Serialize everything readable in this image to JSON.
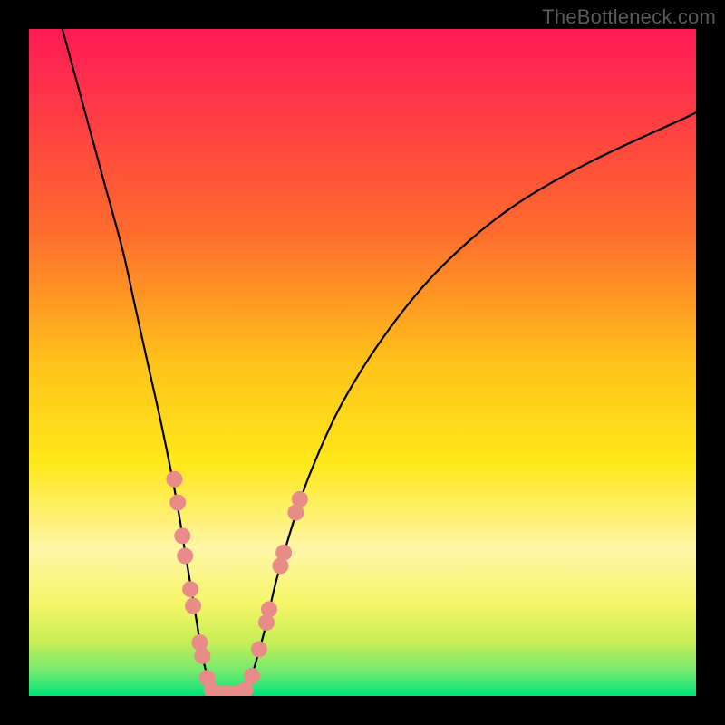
{
  "watermark": "TheBottleneck.com",
  "chart_data": {
    "type": "line",
    "title": "",
    "xlabel": "",
    "ylabel": "",
    "xlim": [
      0,
      100
    ],
    "ylim": [
      0,
      100
    ],
    "background": {
      "type": "vertical-gradient",
      "stops": [
        {
          "offset": 0.0,
          "color": "#ff1a55"
        },
        {
          "offset": 0.12,
          "color": "#ff3a46"
        },
        {
          "offset": 0.3,
          "color": "#ff6a2e"
        },
        {
          "offset": 0.5,
          "color": "#ffc21a"
        },
        {
          "offset": 0.65,
          "color": "#ffe81a"
        },
        {
          "offset": 0.78,
          "color": "#fef6a8"
        },
        {
          "offset": 0.86,
          "color": "#f6f66a"
        },
        {
          "offset": 0.92,
          "color": "#c6ee55"
        },
        {
          "offset": 0.965,
          "color": "#6fe96f"
        },
        {
          "offset": 1.0,
          "color": "#00e47a"
        }
      ]
    },
    "series": [
      {
        "name": "bottleneck-curve",
        "color": "#000000",
        "x": [
          5,
          8,
          11,
          14,
          16,
          18,
          20,
          22,
          23.5,
          25,
          26,
          27,
          27.5,
          28,
          30,
          32,
          33,
          34,
          35.5,
          37,
          39,
          42,
          47,
          54,
          62,
          72,
          84,
          98,
          100
        ],
        "y": [
          100,
          89,
          78,
          67,
          58,
          49,
          40,
          30,
          21,
          12,
          6,
          2,
          0.6,
          0.4,
          0.4,
          0.6,
          2,
          5,
          10.5,
          17,
          24,
          33,
          44,
          55,
          64.5,
          73,
          80,
          86.5,
          87.5
        ]
      }
    ],
    "markers": {
      "name": "data-points",
      "color": "#e98b88",
      "radius_px": 9,
      "points": [
        {
          "x": 21.8,
          "y": 32.5
        },
        {
          "x": 22.3,
          "y": 29.0
        },
        {
          "x": 23.0,
          "y": 24.0
        },
        {
          "x": 23.4,
          "y": 21.0
        },
        {
          "x": 24.2,
          "y": 16.0
        },
        {
          "x": 24.6,
          "y": 13.5
        },
        {
          "x": 25.6,
          "y": 8.0
        },
        {
          "x": 26.0,
          "y": 6.0
        },
        {
          "x": 26.7,
          "y": 2.7
        },
        {
          "x": 27.4,
          "y": 0.9
        },
        {
          "x": 28.4,
          "y": 0.4
        },
        {
          "x": 29.6,
          "y": 0.4
        },
        {
          "x": 31.0,
          "y": 0.4
        },
        {
          "x": 32.4,
          "y": 0.9
        },
        {
          "x": 33.4,
          "y": 3.0
        },
        {
          "x": 34.5,
          "y": 7.0
        },
        {
          "x": 35.6,
          "y": 11.0
        },
        {
          "x": 36.0,
          "y": 13.0
        },
        {
          "x": 37.7,
          "y": 19.5
        },
        {
          "x": 38.2,
          "y": 21.5
        },
        {
          "x": 40.0,
          "y": 27.5
        },
        {
          "x": 40.6,
          "y": 29.5
        }
      ]
    }
  }
}
